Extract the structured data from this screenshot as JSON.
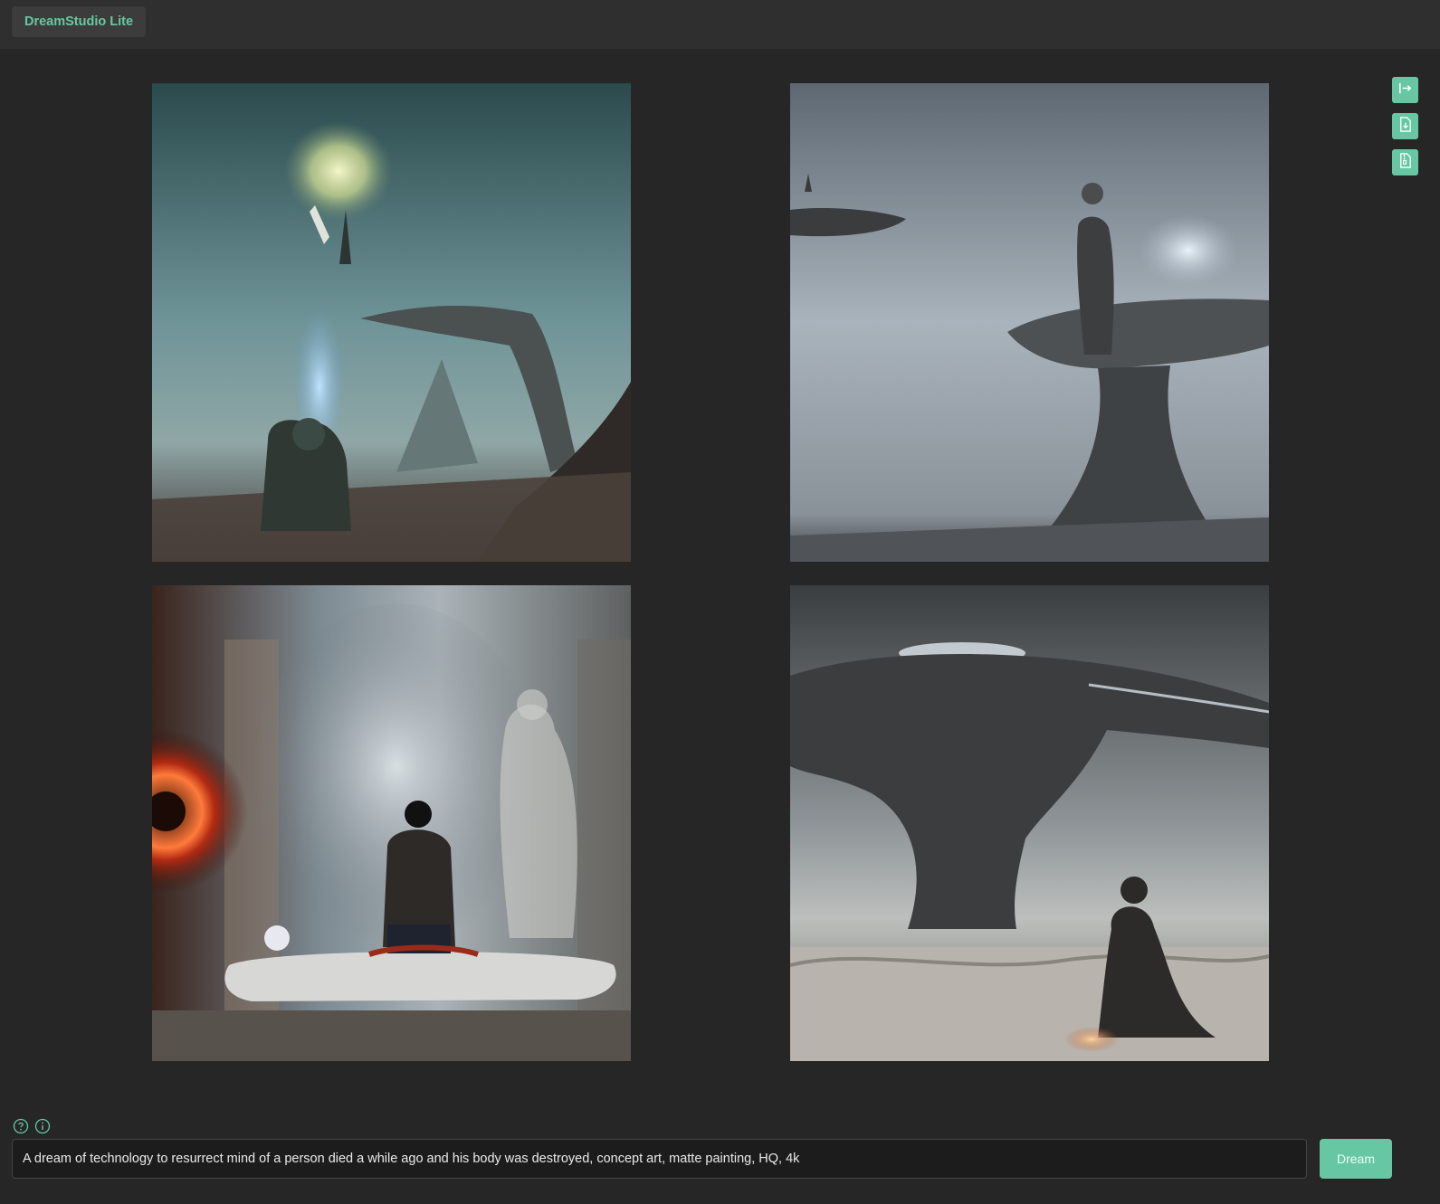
{
  "app": {
    "title": "DreamStudio Lite",
    "accent_color": "#67c7a4",
    "background_color": "#262626"
  },
  "toolbar": {
    "buttons": [
      {
        "icon": "export-arrow-icon"
      },
      {
        "icon": "file-download-icon"
      },
      {
        "icon": "file-zip-icon"
      }
    ]
  },
  "gallery": {
    "images": [
      {
        "icon": "generated-image-1"
      },
      {
        "icon": "generated-image-2"
      },
      {
        "icon": "generated-image-3"
      },
      {
        "icon": "generated-image-4"
      }
    ]
  },
  "prompt": {
    "value": "A dream of technology to resurrect mind of a person died a while ago and his body was destroyed, concept art, matte painting, HQ, 4k",
    "help_icon": "question-circle-icon",
    "info_icon": "info-circle-icon"
  },
  "dream_button": {
    "label": "Dream"
  }
}
